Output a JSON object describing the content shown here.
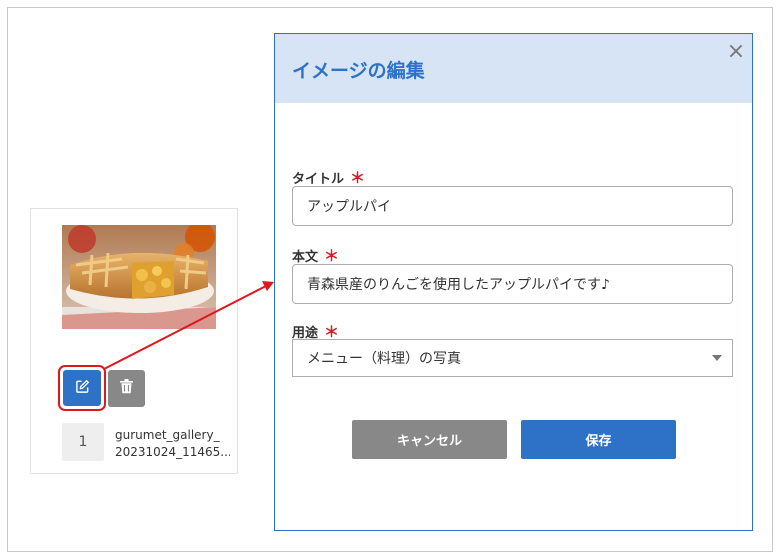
{
  "gallery_card": {
    "order": "1",
    "filename_line1": "gurumet_gallery_",
    "filename_line2": "20231024_11465...",
    "edit_icon": "pencil-square-icon",
    "delete_icon": "trash-icon"
  },
  "modal": {
    "title": "イメージの編集",
    "close_glyph": "×",
    "fields": {
      "title": {
        "label": "タイトル",
        "required_mark": "＊",
        "value": "アップルパイ"
      },
      "body": {
        "label": "本文",
        "required_mark": "＊",
        "value": "青森県産のりんごを使用したアップルパイです♪"
      },
      "usage": {
        "label": "用途",
        "required_mark": "＊",
        "selected": "メニュー（料理）の写真"
      }
    },
    "buttons": {
      "cancel": "キャンセル",
      "save": "保存"
    }
  },
  "colors": {
    "accent": "#2e72c8",
    "header_bg": "#d6e4f5",
    "highlight": "#e0171f",
    "gray_button": "#888888"
  }
}
